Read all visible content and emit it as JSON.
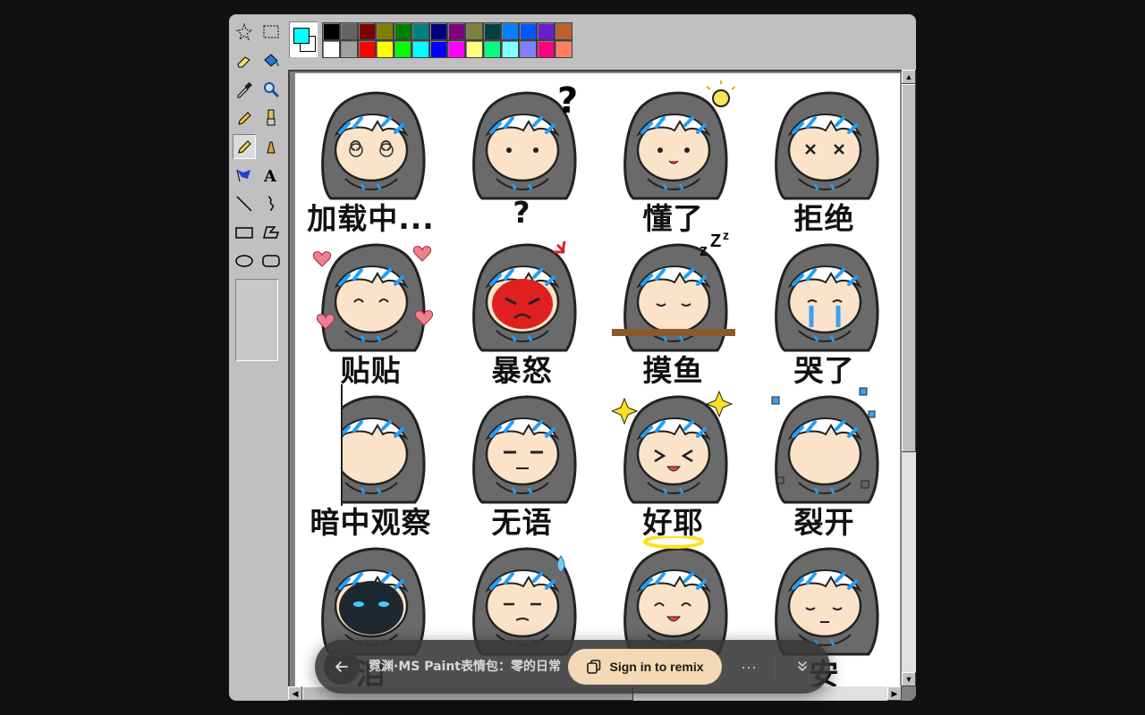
{
  "overlay": {
    "title": "霓渊·MS Paint表情包：零的日常",
    "remix_label": "Sign in to remix",
    "more_label": "···"
  },
  "palette": {
    "foreground": "#00ffff",
    "background": "#ffffff",
    "colors": [
      "#000000",
      "#646464",
      "#800000",
      "#808000",
      "#008000",
      "#008080",
      "#000080",
      "#800080",
      "#808040",
      "#004040",
      "#0080ff",
      "#0057ff",
      "#6a1ecc",
      "#c0602c",
      "#ffffff",
      "#a0a0a0",
      "#ff0000",
      "#ffff00",
      "#00ff00",
      "#00ffff",
      "#0000ff",
      "#ff00ff",
      "#ffff80",
      "#00ff80",
      "#80ffff",
      "#8080ff",
      "#ff0080",
      "#ff8060"
    ]
  },
  "toolbox": {
    "tools": [
      "free-form-select",
      "rect-select",
      "eraser",
      "fill",
      "color-picker",
      "magnifier",
      "pencil",
      "brush",
      "highlighter",
      "airbrush",
      "color-brush",
      "text",
      "line",
      "curve",
      "rectangle",
      "polygon",
      "ellipse",
      "rounded-rectangle"
    ],
    "active": "highlighter"
  },
  "stickers": [
    {
      "caption": "加载中...",
      "mood": "dizzy"
    },
    {
      "caption": "?",
      "mood": "question"
    },
    {
      "caption": "懂了",
      "mood": "idea"
    },
    {
      "caption": "拒绝",
      "mood": "refuse"
    },
    {
      "caption": "贴贴",
      "mood": "hearts"
    },
    {
      "caption": "暴怒",
      "mood": "angry"
    },
    {
      "caption": "摸鱼",
      "mood": "sleep"
    },
    {
      "caption": "哭了",
      "mood": "cry"
    },
    {
      "caption": "暗中观察",
      "mood": "peek"
    },
    {
      "caption": "无语",
      "mood": "speechless"
    },
    {
      "caption": "好耶",
      "mood": "yay"
    },
    {
      "caption": "裂开",
      "mood": "broken"
    },
    {
      "caption": "泪",
      "mood": "dark"
    },
    {
      "caption": "",
      "mood": "sweat"
    },
    {
      "caption": "",
      "mood": "angel"
    },
    {
      "caption": "安",
      "mood": "rest"
    }
  ]
}
